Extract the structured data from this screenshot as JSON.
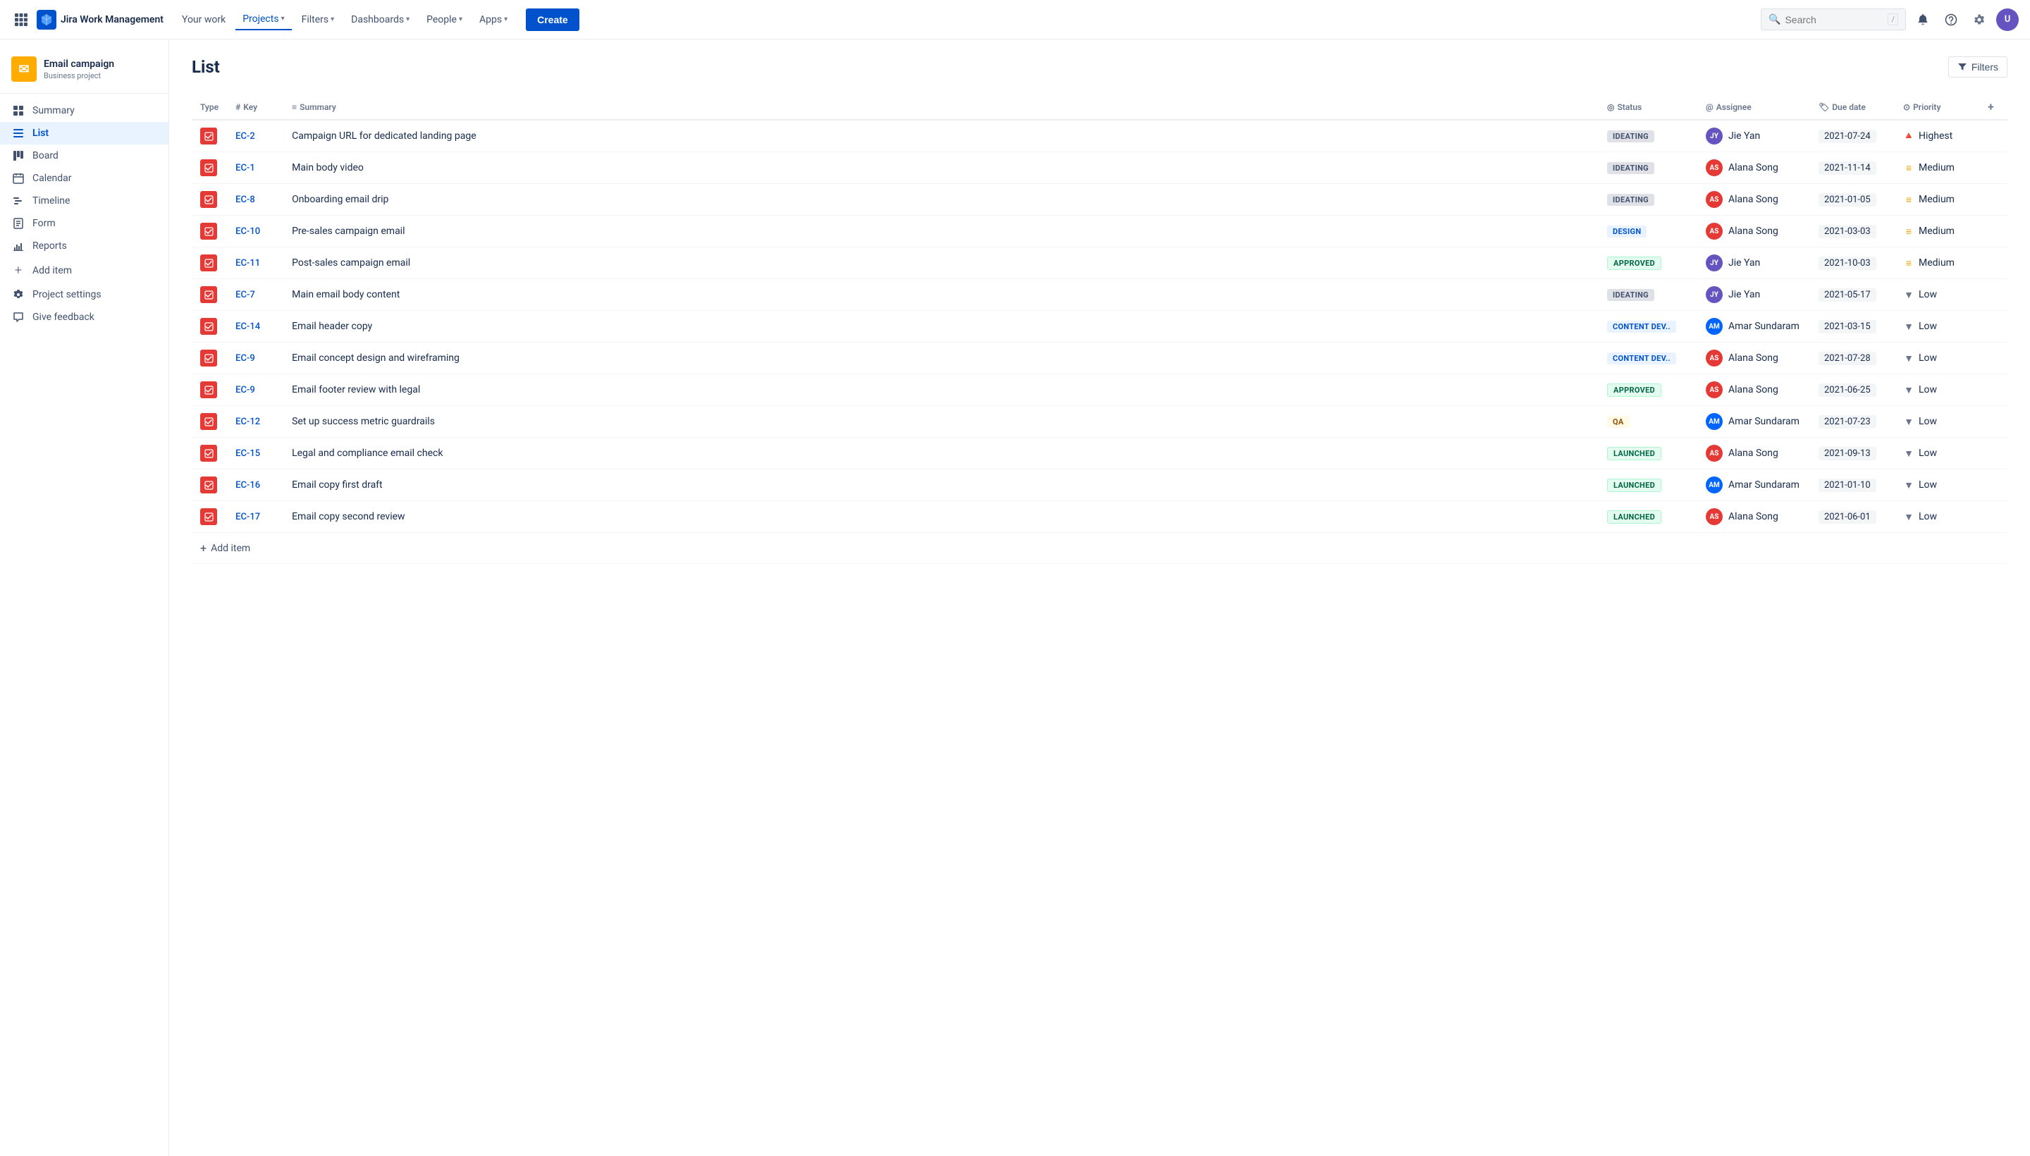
{
  "topnav": {
    "logo_text": "Jira Work Management",
    "nav_items": [
      {
        "label": "Your work",
        "active": false
      },
      {
        "label": "Projects",
        "active": true
      },
      {
        "label": "Filters",
        "active": false
      },
      {
        "label": "Dashboards",
        "active": false
      },
      {
        "label": "People",
        "active": false
      },
      {
        "label": "Apps",
        "active": false
      }
    ],
    "create_label": "Create",
    "search_placeholder": "Search",
    "search_kbd": "/"
  },
  "sidebar": {
    "project_name": "Email campaign",
    "project_type": "Business project",
    "project_icon": "✉",
    "items": [
      {
        "label": "Summary",
        "icon": "▦",
        "active": false
      },
      {
        "label": "List",
        "icon": "≡",
        "active": true
      },
      {
        "label": "Board",
        "icon": "⊞",
        "active": false
      },
      {
        "label": "Calendar",
        "icon": "📅",
        "active": false
      },
      {
        "label": "Timeline",
        "icon": "⚡",
        "active": false
      },
      {
        "label": "Form",
        "icon": "📋",
        "active": false
      },
      {
        "label": "Reports",
        "icon": "📈",
        "active": false
      },
      {
        "label": "Add item",
        "icon": "+",
        "active": false
      },
      {
        "label": "Project settings",
        "icon": "⚙",
        "active": false
      },
      {
        "label": "Give feedback",
        "icon": "📢",
        "active": false
      }
    ]
  },
  "page": {
    "title": "List",
    "filters_label": "Filters"
  },
  "table": {
    "columns": [
      "Type",
      "Key",
      "Summary",
      "Status",
      "Assignee",
      "Due date",
      "Priority"
    ],
    "add_col_icon": "+",
    "rows": [
      {
        "type": "task",
        "key": "EC-2",
        "summary": "Campaign URL for dedicated landing page",
        "status": "IDEATING",
        "status_class": "status-ideating",
        "assignee": "Jie Yan",
        "assignee_av": "JY",
        "assignee_class": "av-jie",
        "due_date": "2021-07-24",
        "priority": "Highest",
        "priority_icon": "🔺"
      },
      {
        "type": "task",
        "key": "EC-1",
        "summary": "Main body video",
        "status": "IDEATING",
        "status_class": "status-ideating",
        "assignee": "Alana Song",
        "assignee_av": "AS",
        "assignee_class": "av-alana",
        "due_date": "2021-11-14",
        "priority": "Medium",
        "priority_icon": "≡"
      },
      {
        "type": "task",
        "key": "EC-8",
        "summary": "Onboarding email drip",
        "status": "IDEATING",
        "status_class": "status-ideating",
        "assignee": "Alana Song",
        "assignee_av": "AS",
        "assignee_class": "av-alana",
        "due_date": "2021-01-05",
        "priority": "Medium",
        "priority_icon": "≡"
      },
      {
        "type": "task",
        "key": "EC-10",
        "summary": "Pre-sales campaign email",
        "status": "DESIGN",
        "status_class": "status-design",
        "assignee": "Alana Song",
        "assignee_av": "AS",
        "assignee_class": "av-alana",
        "due_date": "2021-03-03",
        "priority": "Medium",
        "priority_icon": "≡"
      },
      {
        "type": "task",
        "key": "EC-11",
        "summary": "Post-sales campaign email",
        "status": "APPROVED",
        "status_class": "status-approved",
        "assignee": "Jie Yan",
        "assignee_av": "JY",
        "assignee_class": "av-jie",
        "due_date": "2021-10-03",
        "priority": "Medium",
        "priority_icon": "≡"
      },
      {
        "type": "task",
        "key": "EC-7",
        "summary": "Main email body content",
        "status": "IDEATING",
        "status_class": "status-ideating",
        "assignee": "Jie Yan",
        "assignee_av": "JY",
        "assignee_class": "av-jie",
        "due_date": "2021-05-17",
        "priority": "Low",
        "priority_icon": "▼"
      },
      {
        "type": "task",
        "key": "EC-14",
        "summary": "Email header copy",
        "status": "CONTENT DEV..",
        "status_class": "status-content-dev",
        "assignee": "Amar Sundaram",
        "assignee_av": "AM",
        "assignee_class": "av-amar",
        "due_date": "2021-03-15",
        "priority": "Low",
        "priority_icon": "▼"
      },
      {
        "type": "task",
        "key": "EC-9",
        "summary": "Email concept design and wireframing",
        "status": "CONTENT DEV..",
        "status_class": "status-content-dev",
        "assignee": "Alana Song",
        "assignee_av": "AS",
        "assignee_class": "av-alana",
        "due_date": "2021-07-28",
        "priority": "Low",
        "priority_icon": "▼"
      },
      {
        "type": "task",
        "key": "EC-9",
        "summary": "Email footer review with legal",
        "status": "APPROVED",
        "status_class": "status-approved",
        "assignee": "Alana Song",
        "assignee_av": "AS",
        "assignee_class": "av-alana",
        "due_date": "2021-06-25",
        "priority": "Low",
        "priority_icon": "▼"
      },
      {
        "type": "task",
        "key": "EC-12",
        "summary": "Set up success metric guardrails",
        "status": "QA",
        "status_class": "status-qa",
        "assignee": "Amar Sundaram",
        "assignee_av": "AM",
        "assignee_class": "av-amar",
        "due_date": "2021-07-23",
        "priority": "Low",
        "priority_icon": "▼"
      },
      {
        "type": "task",
        "key": "EC-15",
        "summary": "Legal and compliance email check",
        "status": "LAUNCHED",
        "status_class": "status-launched",
        "assignee": "Alana Song",
        "assignee_av": "AS",
        "assignee_class": "av-alana",
        "due_date": "2021-09-13",
        "priority": "Low",
        "priority_icon": "▼"
      },
      {
        "type": "task",
        "key": "EC-16",
        "summary": "Email copy first draft",
        "status": "LAUNCHED",
        "status_class": "status-launched",
        "assignee": "Amar Sundaram",
        "assignee_av": "AM",
        "assignee_class": "av-amar",
        "due_date": "2021-01-10",
        "priority": "Low",
        "priority_icon": "▼"
      },
      {
        "type": "task",
        "key": "EC-17",
        "summary": "Email copy second review",
        "status": "LAUNCHED",
        "status_class": "status-launched",
        "assignee": "Alana Song",
        "assignee_av": "AS",
        "assignee_class": "av-alana",
        "due_date": "2021-06-01",
        "priority": "Low",
        "priority_icon": "▼"
      }
    ],
    "add_item_label": "+ Add item"
  }
}
